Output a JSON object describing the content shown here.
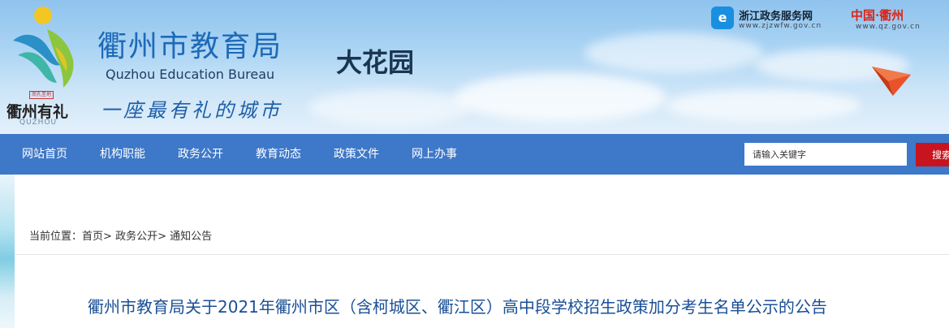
{
  "header": {
    "logo": {
      "seal_text": "南孔圣地",
      "name_cn": "衢州有礼",
      "name_en": "QUZHOU"
    },
    "title_cn": "衢州市教育局",
    "title_en": "Quzhou Education Bureau",
    "slogan": "一座最有礼的城市",
    "site_name": "大花园",
    "links": {
      "zj_icon": "e",
      "zj_name": "浙江政务服务网",
      "zj_url": "www.zjzwfw.gov.cn",
      "qz_name": "中国·衢州",
      "qz_url": "www.qz.gov.cn"
    }
  },
  "nav": {
    "items": [
      {
        "label": "网站首页"
      },
      {
        "label": "机构职能"
      },
      {
        "label": "政务公开"
      },
      {
        "label": "教育动态"
      },
      {
        "label": "政策文件"
      },
      {
        "label": "网上办事"
      }
    ],
    "search": {
      "placeholder": "请输入关键字",
      "button_label": "搜索"
    }
  },
  "breadcrumb": {
    "prefix": "当前位置：",
    "items": [
      "首页",
      "政务公开",
      "通知公告"
    ],
    "separator": ">"
  },
  "article": {
    "title": "衢州市教育局关于2021年衢州市区（含柯城区、衢江区）高中段学校招生政策加分考生名单公示的公告"
  },
  "colors": {
    "nav_bg": "#3e78c8",
    "search_button": "#c8141e",
    "title_blue": "#1e6ab7",
    "article_title": "#1a4f96"
  },
  "icons": [
    "logo-emblem-icon",
    "zjzwfw-logo-icon",
    "paper-plane-icon"
  ]
}
